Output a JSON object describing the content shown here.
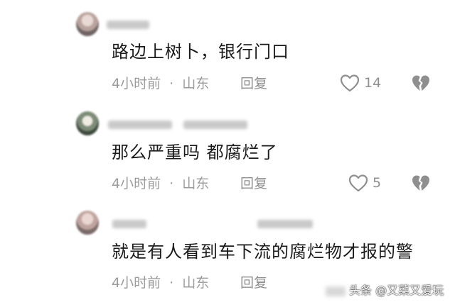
{
  "comments": [
    {
      "username": "",
      "text": "路边上树卜，银行门口",
      "time": "4小时前",
      "location": "山东",
      "meta_separator": "·",
      "reply_label": "回复",
      "like_count": "14",
      "like_icon": "heart-outline-icon",
      "dislike_icon": "broken-heart-icon"
    },
    {
      "username": "",
      "text": "那么严重吗   都腐烂了",
      "time": "4小时前",
      "location": "山东",
      "meta_separator": "·",
      "reply_label": "回复",
      "like_count": "5",
      "like_icon": "heart-outline-icon",
      "dislike_icon": "broken-heart-icon"
    },
    {
      "username": "",
      "text": "就是有人看到车下流的腐烂物才报的警",
      "time": "4小时前",
      "location": "山东",
      "meta_separator": "·",
      "reply_label": "回复"
    }
  ],
  "watermark": "头条 @又菜又爱玩",
  "colors": {
    "text": "#1a1a1a",
    "meta": "#9b9b9b",
    "icon": "#8f8f8f",
    "background": "#ffffff"
  }
}
